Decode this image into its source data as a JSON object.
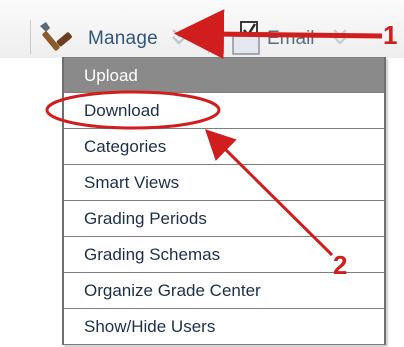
{
  "toolbar": {
    "manage_label": "Manage",
    "manage_icon": "manage-tool-icon",
    "email_label": "Email",
    "email_icon": "email-checkbox-icon"
  },
  "menu": {
    "items": [
      {
        "label": "Upload",
        "active": true
      },
      {
        "label": "Download",
        "active": false
      },
      {
        "label": "Categories",
        "active": false
      },
      {
        "label": "Smart Views",
        "active": false
      },
      {
        "label": "Grading Periods",
        "active": false
      },
      {
        "label": "Grading Schemas",
        "active": false
      },
      {
        "label": "Organize Grade Center",
        "active": false
      },
      {
        "label": "Show/Hide Users",
        "active": false
      }
    ]
  },
  "annotations": {
    "callout_1": "1",
    "callout_2": "2",
    "color": "#d01e1e"
  }
}
